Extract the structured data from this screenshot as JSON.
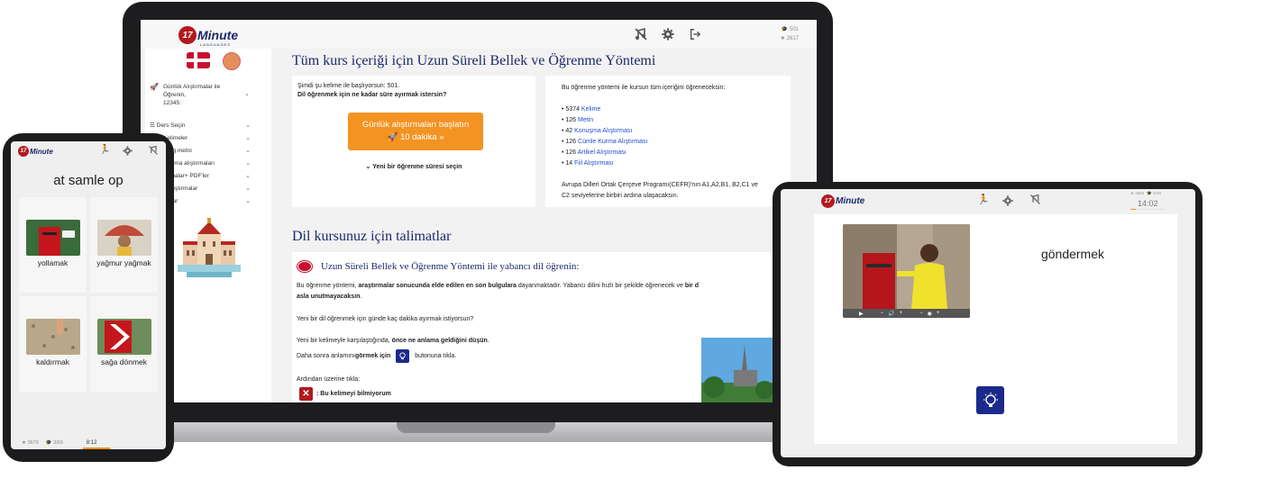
{
  "laptop": {
    "logo": {
      "number": "17",
      "word": "Minute",
      "sub": "LANGUAGES"
    },
    "stats": {
      "trophy": "501",
      "star": "2617"
    },
    "sidebar": {
      "daily_item": {
        "label_line1": "Günlük Alıştırmalar ile",
        "label_line2": "Öğrenin,",
        "label_line3": "12345:"
      },
      "items": [
        {
          "label": "Ders Seçin"
        },
        {
          "label": "Kelimeler"
        },
        {
          "label": "...log metni"
        },
        {
          "label": "...uşma alıştırmaları"
        },
        {
          "label": "...rmalar+ PDF'ler"
        },
        {
          "label": "...Alıştırmalar"
        },
        {
          "label": "...alar"
        }
      ]
    },
    "main": {
      "title": "Tüm kurs içeriği için Uzun Süreli Bellek ve Öğrenme Yöntemi",
      "left_card": {
        "line1": "Şimdi şu kelime ile başlıyorsun: 501.",
        "line2": "Dil öğrenmek için ne kadar süre ayırmak istersin?",
        "button_line1": "Günlük alıştırmaları başlatın",
        "button_line2": "10 dakika »",
        "select_link": "Yeni bir öğrenme süresi seçin"
      },
      "right_card": {
        "intro": "Bu öğrenme yöntemi ile kursun tüm içeriğini öğreneceksin:",
        "items": [
          {
            "count": "• 5374",
            "link": "Kelime"
          },
          {
            "count": "• 126",
            "link": "Metin"
          },
          {
            "count": "• 42",
            "link": "Konuşma Alıştırması"
          },
          {
            "count": "• 126",
            "link": "Cümle Kurma Alıştırması"
          },
          {
            "count": "• 126",
            "link": "Artikel Alıştırması"
          },
          {
            "count": "• 14",
            "link": "Fiil Alıştırması"
          }
        ],
        "footer_line1": "Avrupa Dilleri Ortak Çerçeve Programı(CEFR)'nın A1,A2,B1, B2,C1 ve",
        "footer_line2": "C2 seviyelerine birbiri ardına ulaşacaksın."
      },
      "instructions_title": "Dil kursunuz için talimatlar",
      "instr_card": {
        "heading": "Uzun Süreli Bellek ve Öğrenme Yöntemi ile yabancı dil öğrenin:",
        "p1_a": "Bu öğrenme yöntemi, ",
        "p1_b": "araştırmalar sonucunda elde edilen en son bulgulara",
        "p1_c": " dayanmaktadır. Yabancı dilini hızlı bir şekilde öğrenecek ve ",
        "p1_d": "bir d",
        "p1_e": "asla unutmayacaksın",
        "p1_f": ".",
        "p2": "Yeni bir dil öğrenmek için günde kaç dakika ayırmak istiyorsun?",
        "p3_a": "Yeni bir kelimeyle karşılaştığında, ",
        "p3_b": "önce ne anlama geldiğini düşün",
        "p3_c": ".",
        "p4_a": "Daha sonra anlamını ",
        "p4_b": "görmek için",
        "p4_c": " butonuna tıkla.",
        "p5": "Ardından üzerine tıkla:",
        "p6": ": Bu kelimeyi bilmiyorum"
      }
    }
  },
  "phone": {
    "logo": {
      "number": "17",
      "word": "Minute"
    },
    "title": "at samle op",
    "tiles": [
      {
        "label": "yollamak"
      },
      {
        "label": "yağmur yağmak"
      },
      {
        "label": "kaldırmak"
      },
      {
        "label": "sağa dönmek"
      }
    ],
    "footer": {
      "star": "★ 3679",
      "trophy": "🎓 3/69",
      "time": "8:12"
    }
  },
  "tablet": {
    "logo": {
      "number": "17",
      "word": "Minute"
    },
    "stats": {
      "star": "★ 3684",
      "trophy": "🎓 5/49"
    },
    "time": "14:02",
    "word": "göndermek"
  },
  "colors": {
    "brand_navy": "#1b2a6b",
    "brand_red": "#b3191f",
    "accent_orange": "#f39322",
    "link_blue": "#1f4fd1"
  },
  "icons": [
    "no-music-icon",
    "gear-icon",
    "logout-icon",
    "trophy-icon",
    "star-icon",
    "calendar-icon",
    "list-icon",
    "chevron-down-icon",
    "lightbulb-icon",
    "close-icon",
    "play-icon",
    "volume-icon",
    "running-icon"
  ]
}
